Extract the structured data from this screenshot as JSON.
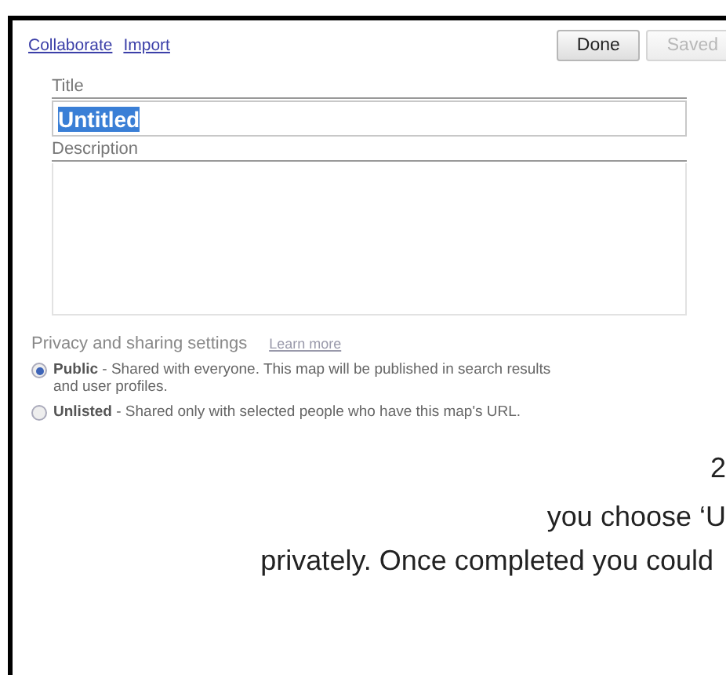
{
  "links": [
    {
      "label": "Collaborate"
    },
    {
      "label": "Import"
    }
  ],
  "buttons": [
    {
      "label": "Done",
      "disabled": false
    },
    {
      "label": "Saved",
      "disabled": true
    }
  ],
  "title_field": {
    "label": "Title",
    "value": "Untitled",
    "highlighted": true
  },
  "description_field": {
    "label": "Description"
  },
  "privacy": {
    "heading": "Privacy and sharing settings",
    "link": "Learn more",
    "options": [
      {
        "name": "Public",
        "text": "- Shared with everyone. This map will be published in search results and user profiles.",
        "selected": true
      },
      {
        "name": "Unlisted",
        "text": "- Shared only with selected people who have this map's URL.",
        "selected": false
      }
    ]
  },
  "document_text": [
    {
      "text": "2"
    },
    {
      "text": "you choose ‘U"
    },
    {
      "text": "privately. Once completed you could"
    }
  ]
}
